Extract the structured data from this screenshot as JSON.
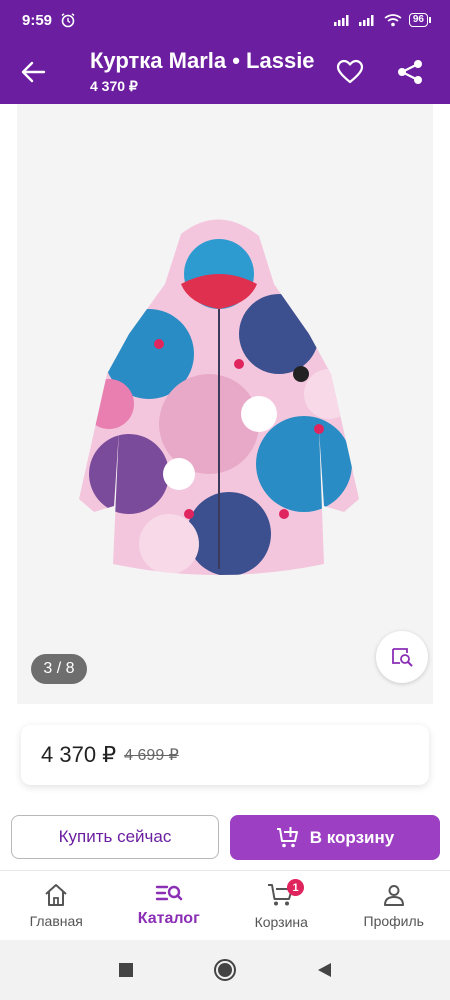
{
  "status_bar": {
    "time": "9:59",
    "battery": "96",
    "icons": [
      "alarm-icon",
      "signal-icon",
      "signal-icon",
      "wifi-icon",
      "battery-icon"
    ]
  },
  "app_bar": {
    "title": "Куртка Marla • Lassie",
    "price": "4 370 ₽",
    "icons": [
      "back-arrow-icon",
      "heart-icon",
      "share-icon"
    ]
  },
  "gallery": {
    "counter": "3 / 8",
    "image_alt": "Детская куртка с цветочным принтом",
    "colors": {
      "background": "#f4f4f4",
      "counter_bg": "#6e6e6e"
    }
  },
  "price_block": {
    "current": "4 370 ₽",
    "old": "4 699 ₽"
  },
  "actions": {
    "buy_now": "Купить сейчас",
    "add_to_cart": "В корзину"
  },
  "bottom_nav": {
    "items": [
      {
        "label": "Главная",
        "icon": "home-icon"
      },
      {
        "label": "Каталог",
        "icon": "catalog-search-icon",
        "active": true
      },
      {
        "label": "Корзина",
        "icon": "cart-icon",
        "badge": "1"
      },
      {
        "label": "Профиль",
        "icon": "profile-icon"
      }
    ]
  },
  "theme": {
    "primary": "#6b1fa0",
    "accent": "#9c3fc3",
    "badge": "#e0245e"
  }
}
